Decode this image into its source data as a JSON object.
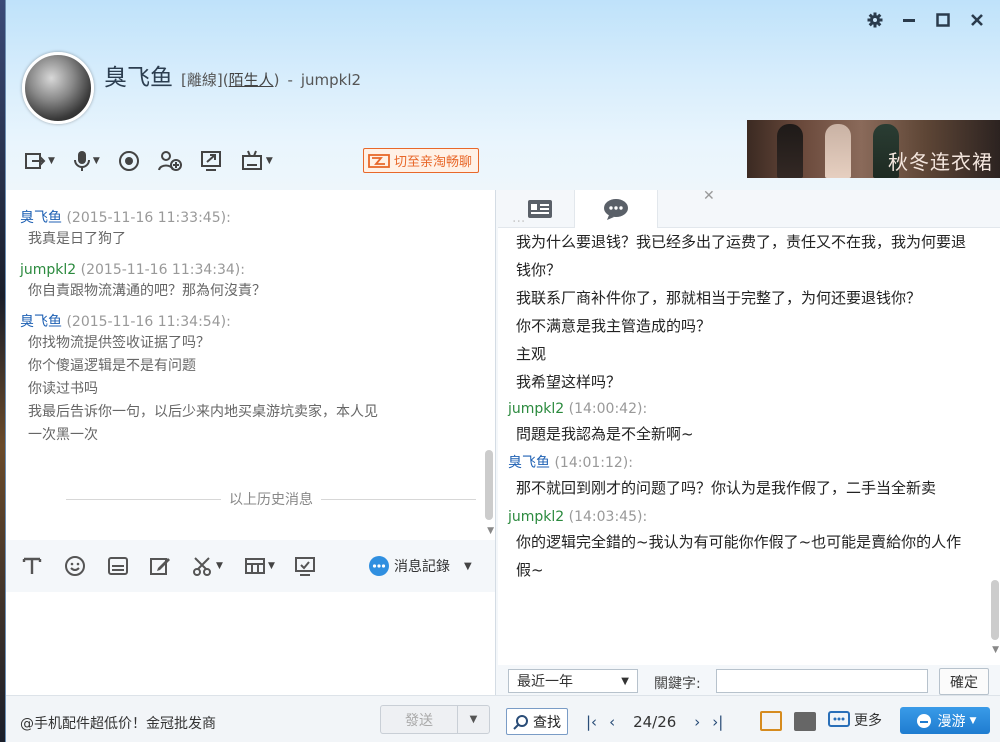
{
  "window_controls": [
    "gear-icon",
    "minimize-icon",
    "maximize-icon",
    "close-icon"
  ],
  "contact": {
    "name": "臭飞鱼",
    "status": "[離線](",
    "relation": "陌生人",
    "relation_close": ")",
    "separator": "-",
    "user_id": "jumpkl2"
  },
  "toolbar": {
    "items": [
      "file-transfer-icon",
      "microphone-icon",
      "video-icon",
      "add-friend-icon",
      "screen-share-icon",
      "remote-assist-icon"
    ],
    "taobao_label": "切至亲淘畅聊"
  },
  "ad_banner": {
    "text": "秋冬连衣裙"
  },
  "history": {
    "messages": [
      {
        "sender": "臭飞鱼",
        "time": "(2015-11-16 11:33:45):",
        "lines": [
          "我真是日了狗了"
        ]
      },
      {
        "sender": "jumpkl2",
        "time": "(2015-11-16 11:34:34):",
        "lines": [
          "你自責跟物流溝通的吧？那為何沒責？"
        ]
      },
      {
        "sender": "臭飞鱼",
        "time": "(2015-11-16 11:34:54):",
        "lines": [
          "你找物流提供签收证据了吗？",
          "你个傻逼逻辑是不是有问题",
          "你读过书吗",
          "我最后告诉你一句，以后少来内地买桌游坑卖家，本人见",
          "一次黑一次"
        ]
      }
    ],
    "divider": "以上历史消息"
  },
  "input_toolbar": {
    "icons": [
      "font-icon",
      "emoji-icon",
      "image-icon",
      "edit-icon",
      "screenshot-scissors-icon",
      "shake-icon",
      "screen-icon"
    ],
    "records_label": "消息記錄"
  },
  "footer": {
    "ad_text": "@手机配件超低价！金冠批发商",
    "send_label": "發送",
    "find_label": "查找",
    "page": "24/26",
    "more_label": "更多",
    "roam_label": "漫游"
  },
  "records_panel": {
    "tabs": [
      "contact-card-icon",
      "chat-bubble-icon"
    ],
    "messages": [
      {
        "sender": "",
        "time": "",
        "lines": [
          "我为什么要退钱？我已经多出了运费了，责任又不在我，我为何要退钱你？",
          "我联系厂商补件你了，那就相当于完整了，为何还要退钱你？",
          "你不满意是我主管造成的吗？",
          "主观",
          "我希望这样吗？"
        ]
      },
      {
        "sender": "jumpkl2",
        "time": "(14:00:42):",
        "lines": [
          "問題是我認為是不全新啊~"
        ]
      },
      {
        "sender": "臭飞鱼",
        "time": "(14:01:12):",
        "lines": [
          "那不就回到刚才的问题了吗？你认为是我作假了，二手当全新卖"
        ]
      },
      {
        "sender": "jumpkl2",
        "time": "(14:03:45):",
        "lines": [
          "你的逻辑完全錯的~我认为有可能你作假了~也可能是賣給你的人作假~"
        ]
      }
    ],
    "range_select": "最近一年",
    "keyword_label": "關鍵字:",
    "keyword_value": "",
    "confirm_label": "確定"
  },
  "colors": {
    "accent": "#2062b4",
    "green": "#2b8a3e",
    "orange": "#e8682a",
    "roam": "#1f7cd0"
  }
}
